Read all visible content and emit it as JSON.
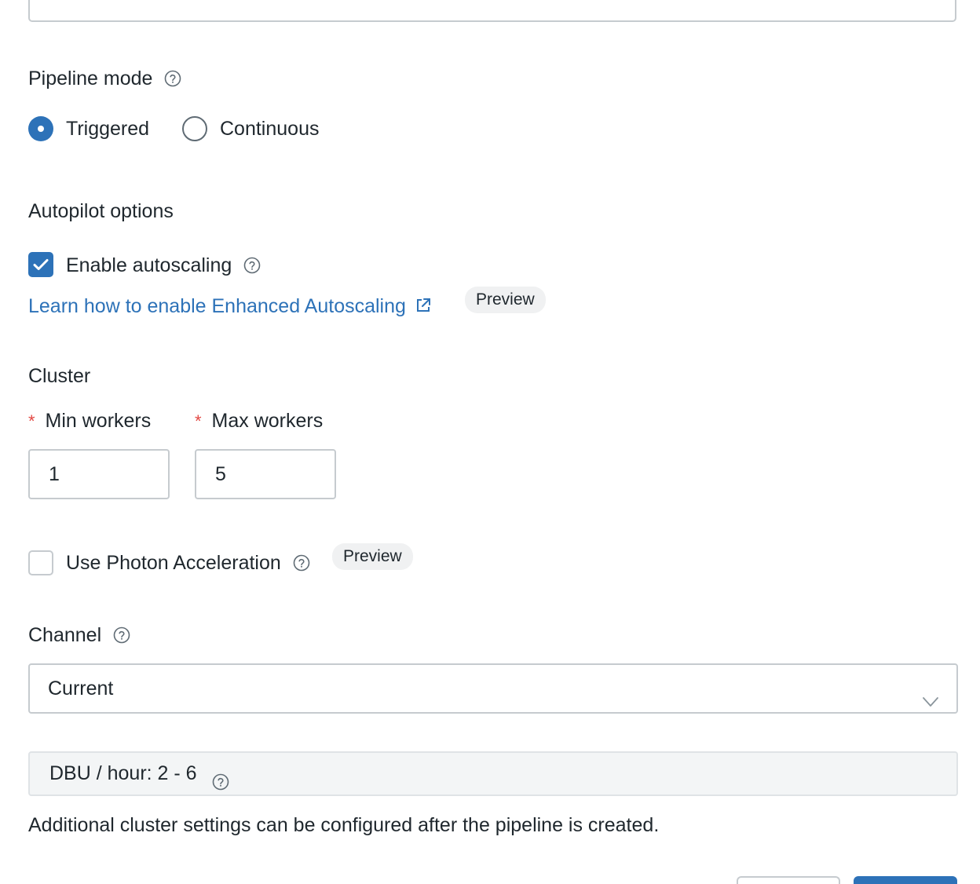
{
  "pipeline_mode": {
    "label": "Pipeline mode",
    "options": [
      {
        "label": "Triggered",
        "selected": true
      },
      {
        "label": "Continuous",
        "selected": false
      }
    ]
  },
  "autopilot": {
    "label": "Autopilot options",
    "enable_autoscaling": {
      "label": "Enable autoscaling",
      "checked": true
    },
    "learn_link": "Learn how to enable Enhanced Autoscaling",
    "preview_badge": "Preview"
  },
  "cluster": {
    "label": "Cluster",
    "required_mark": "*",
    "min_workers": {
      "label": "Min workers",
      "value": "1"
    },
    "max_workers": {
      "label": "Max workers",
      "value": "5"
    }
  },
  "photon": {
    "label": "Use Photon Acceleration",
    "checked": false,
    "preview_badge": "Preview"
  },
  "channel": {
    "label": "Channel",
    "selected": "Current"
  },
  "dbu": {
    "text": "DBU / hour: 2 - 6"
  },
  "note": "Additional cluster settings can be configured after the pipeline is created.",
  "colors": {
    "accent": "#2d72b8",
    "required": "#e34843",
    "border": "#c6cbcf"
  }
}
